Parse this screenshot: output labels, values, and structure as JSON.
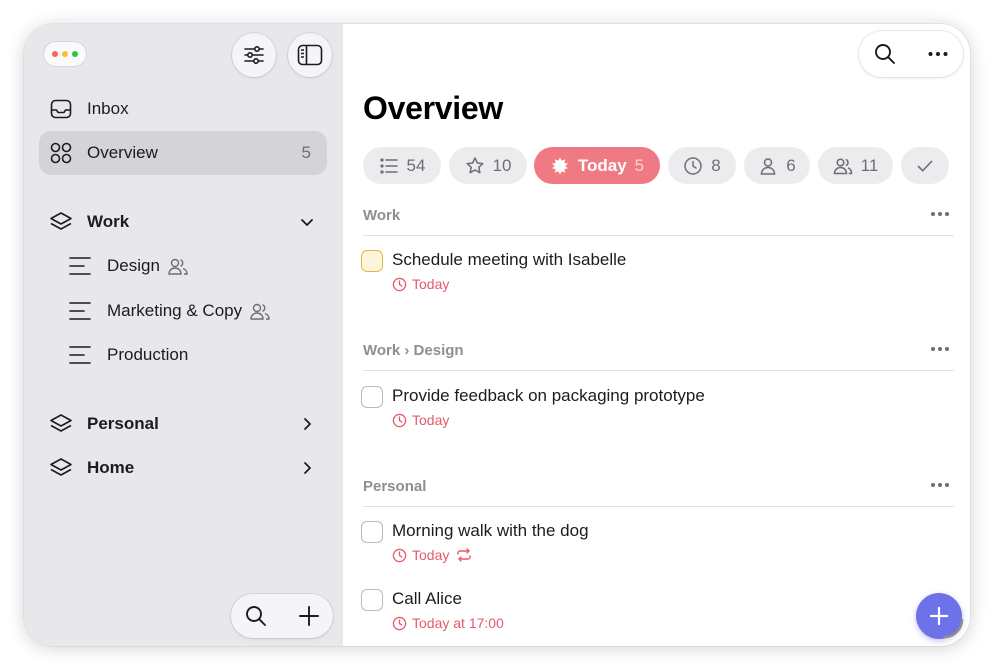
{
  "sidebar": {
    "nav": [
      {
        "label": "Inbox",
        "icon": "inbox-icon",
        "count": ""
      },
      {
        "label": "Overview",
        "icon": "overview-grid-icon",
        "count": "5"
      }
    ],
    "areas": [
      {
        "label": "Work",
        "icon": "layers-icon",
        "expanded": true,
        "projects": [
          {
            "label": "Design",
            "shared": true
          },
          {
            "label": "Marketing & Copy",
            "shared": true
          },
          {
            "label": "Production",
            "shared": false
          }
        ]
      },
      {
        "label": "Personal",
        "icon": "layers-icon",
        "expanded": false
      },
      {
        "label": "Home",
        "icon": "layers-icon",
        "expanded": false
      }
    ]
  },
  "main": {
    "title": "Overview",
    "filters": [
      {
        "icon": "list-icon",
        "label": "",
        "count": "54"
      },
      {
        "icon": "star-icon",
        "label": "",
        "count": "10"
      },
      {
        "icon": "sun-icon",
        "label": "Today",
        "count": "5",
        "active": true
      },
      {
        "icon": "clock-icon",
        "label": "",
        "count": "8"
      },
      {
        "icon": "person-icon",
        "label": "",
        "count": "6"
      },
      {
        "icon": "people-icon",
        "label": "",
        "count": "11"
      },
      {
        "icon": "checkmark-icon",
        "label": "",
        "count": ""
      }
    ],
    "sections": [
      {
        "title": "Work",
        "tasks": [
          {
            "title": "Schedule meeting with Isabelle",
            "due": "Today",
            "repeat": false,
            "highlight": true
          }
        ]
      },
      {
        "title": "Work › Design",
        "tasks": [
          {
            "title": "Provide feedback on packaging prototype",
            "due": "Today",
            "repeat": false
          }
        ]
      },
      {
        "title": "Personal",
        "tasks": [
          {
            "title": "Morning walk with the dog",
            "due": "Today",
            "repeat": true
          },
          {
            "title": "Call Alice",
            "due": "Today at 17:00",
            "repeat": false
          }
        ]
      }
    ]
  },
  "colors": {
    "sidebar_bg": "#e8e8ec",
    "active_chip": "#ef7a84",
    "due_text": "#e45a6a",
    "fab": "#6d72e8"
  }
}
